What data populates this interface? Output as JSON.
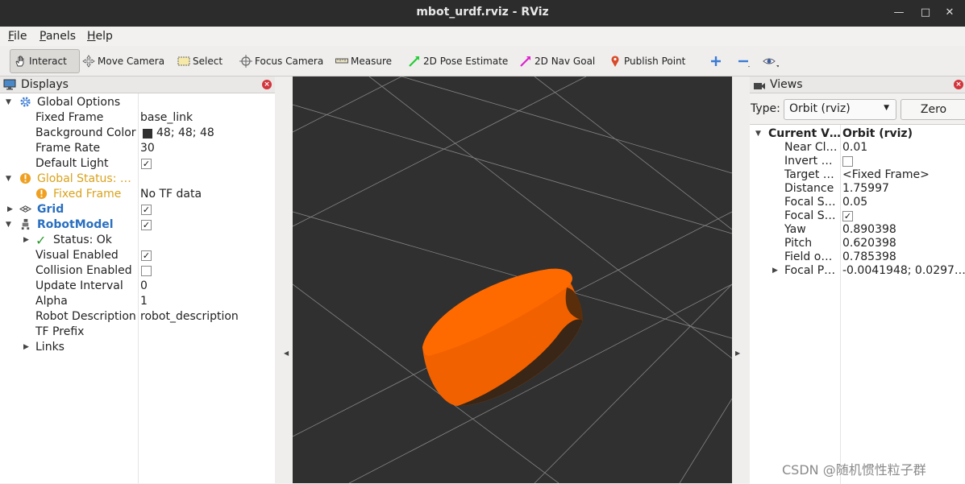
{
  "window": {
    "title": "mbot_urdf.rviz - RViz"
  },
  "menu": [
    {
      "mnemonic": "F",
      "rest": "ile"
    },
    {
      "mnemonic": "P",
      "rest": "anels"
    },
    {
      "mnemonic": "H",
      "rest": "elp"
    }
  ],
  "toolbar": {
    "interact": "Interact",
    "move_camera": "Move Camera",
    "select": "Select",
    "focus_camera": "Focus Camera",
    "measure": "Measure",
    "pose_estimate": "2D Pose Estimate",
    "nav_goal": "2D Nav Goal",
    "publish_point": "Publish Point"
  },
  "displays": {
    "title": "Displays",
    "global_options": "Global Options",
    "fixed_frame_label": "Fixed Frame",
    "fixed_frame_value": "base_link",
    "bg_color_label": "Background Color",
    "bg_color_value": "48; 48; 48",
    "bg_color_hex": "#303030",
    "frame_rate_label": "Frame Rate",
    "frame_rate_value": "30",
    "default_light_label": "Default Light",
    "global_status": "Global Status: …",
    "gs_fixed_frame": "Fixed Frame",
    "gs_fixed_frame_value": "No TF data",
    "grid": "Grid",
    "robot_model": "RobotModel",
    "status_ok": "Status: Ok",
    "visual_enabled": "Visual Enabled",
    "collision_enabled": "Collision Enabled",
    "update_interval_label": "Update Interval",
    "update_interval_value": "0",
    "alpha_label": "Alpha",
    "alpha_value": "1",
    "robot_desc_label": "Robot Description",
    "robot_desc_value": "robot_description",
    "tf_prefix": "TF Prefix",
    "links": "Links"
  },
  "views": {
    "title": "Views",
    "type_label": "Type:",
    "type_value": "Orbit (rviz)",
    "zero_button": "Zero",
    "current_view_label": "Current V…",
    "current_view_value": "Orbit (rviz)",
    "near_clip_label": "Near Cl…",
    "near_clip_value": "0.01",
    "invert_label": "Invert …",
    "target_label": "Target …",
    "target_value": "<Fixed Frame>",
    "distance_label": "Distance",
    "distance_value": "1.75997",
    "focal_scale_label": "Focal S…",
    "focal_scale_value": "0.05",
    "focal_shape_label": "Focal S…",
    "yaw_label": "Yaw",
    "yaw_value": "0.890398",
    "pitch_label": "Pitch",
    "pitch_value": "0.620398",
    "fov_label": "Field o…",
    "fov_value": "0.785398",
    "focal_point_label": "Focal P…",
    "focal_point_value": "-0.0041948; 0.0297…"
  },
  "watermark": "CSDN @随机惯性粒子群",
  "colors": {
    "robot_orange": "#ff6600",
    "accent_blue": "#2a6fc0",
    "warning_orange": "#d9a21b"
  }
}
